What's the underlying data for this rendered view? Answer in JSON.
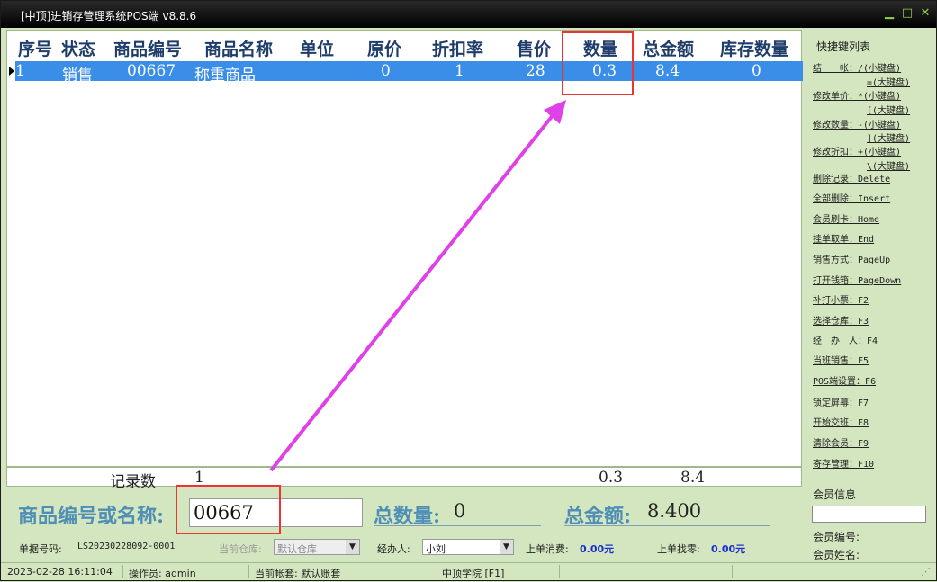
{
  "window": {
    "title": "[中顶]进销存管理系统POS端 v8.8.6"
  },
  "columns": [
    "序号",
    "状态",
    "商品编号",
    "商品名称",
    "单位",
    "原价",
    "折扣率",
    "售价",
    "数量",
    "总金额",
    "库存数量"
  ],
  "rows": [
    {
      "no": "1",
      "status": "销售",
      "code": "00667",
      "name": "称重商品",
      "unit": "",
      "price": "0",
      "discount": "1",
      "sale": "28",
      "qty": "0.3",
      "total": "8.4",
      "stock": "0"
    }
  ],
  "footer": {
    "label": "记录数",
    "count": "1",
    "qty": "0.3",
    "total": "8.4"
  },
  "shortcuts": {
    "title": "快捷键列表",
    "items": [
      "结　　帐：/(小键盘)",
      "=(大键盘)",
      "修改单价：*(小键盘)",
      "[(大键盘)",
      "修改数量：-(小键盘)",
      "](大键盘)",
      "修改折扣：+(小键盘)",
      "\\(大键盘)",
      "删除记录：Delete",
      "全部删除：Insert",
      "会员刷卡：Home",
      "挂单取单：End",
      "销售方式：PageUp",
      "打开钱箱：PageDown",
      "补打小票：F2",
      "选择仓库：F3",
      "经　办　人：F4",
      "当班销售：F5",
      "POS端设置：F6",
      "锁定屏幕：F7",
      "开始交班：F8",
      "清除会员：F9",
      "寄存管理：F10"
    ]
  },
  "entry": {
    "code_label": "商品编号或名称:",
    "code_value": "00667",
    "qty_label": "总数量:",
    "qty_value": "0",
    "amount_label": "总金额:",
    "amount_value": "8.400"
  },
  "info": {
    "bill_label": "单据号码:",
    "bill_no": "LS20230228092-0001",
    "warehouse_label": "当前仓库:",
    "warehouse": "默认仓库",
    "handler_label": "经办人:",
    "handler": "小刘",
    "last_spend_label": "上单消费:",
    "last_spend": "0.00元",
    "last_change_label": "上单找零:",
    "last_change": "0.00元"
  },
  "member": {
    "title": "会员信息",
    "no_label": "会员编号:",
    "name_label": "会员姓名:"
  },
  "status": {
    "datetime": "2023-02-28 16:11:04",
    "operator": "操作员: admin",
    "account": "当前帐套: 默认账套",
    "school": "中顶学院 [F1]"
  },
  "colors": {
    "selection": "#3b8ee8",
    "highlight_box": "#e33",
    "arrow": "#e040e8",
    "bg": "#d4e6bf"
  }
}
